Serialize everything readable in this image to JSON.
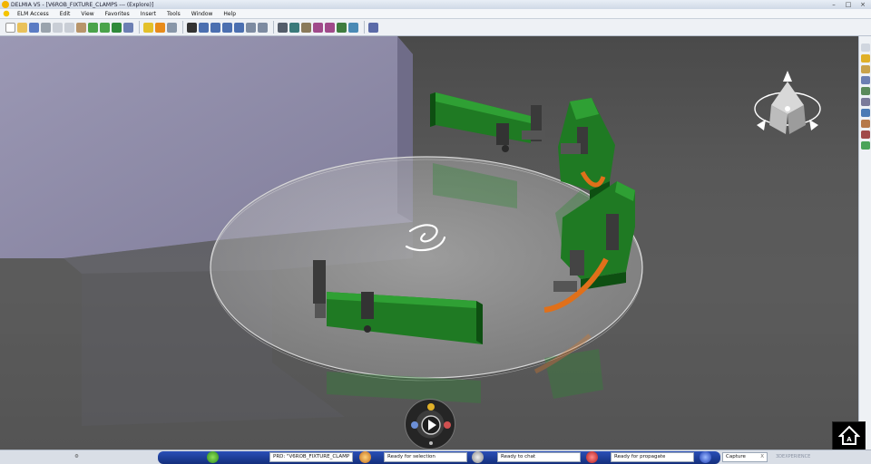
{
  "window": {
    "title": "DELMIA V5 - [V6ROB_FIXTURE_CLAMPS --- (Explore)]",
    "controls": [
      "–",
      "□",
      "×"
    ]
  },
  "menu": {
    "items": [
      "ELM Access",
      "Edit",
      "View",
      "Favorites",
      "Insert",
      "Tools",
      "Window",
      "Help"
    ]
  },
  "status": {
    "selection_field": "PRD: \"V6ROB_FIXTURE_CLAMP",
    "ready_selection": "Ready for selection",
    "ready_chat": "Ready to chat",
    "ready_propagate": "Ready for propagate",
    "capture_label": "Capture",
    "capture_close": "X",
    "brand": "3DEXPERIENCE"
  },
  "colors": {
    "fixture_green": "#1f7a23",
    "clamp_orange": "#e0701a",
    "viewport_gray": "#575757",
    "building_lavender": "#8d8aa6",
    "turntable": "#bfbfbf"
  },
  "icons": {
    "compass": "compass-icon",
    "navigation_wheel": "navigation-wheel-icon",
    "corner_logo": "home-logo-icon"
  }
}
